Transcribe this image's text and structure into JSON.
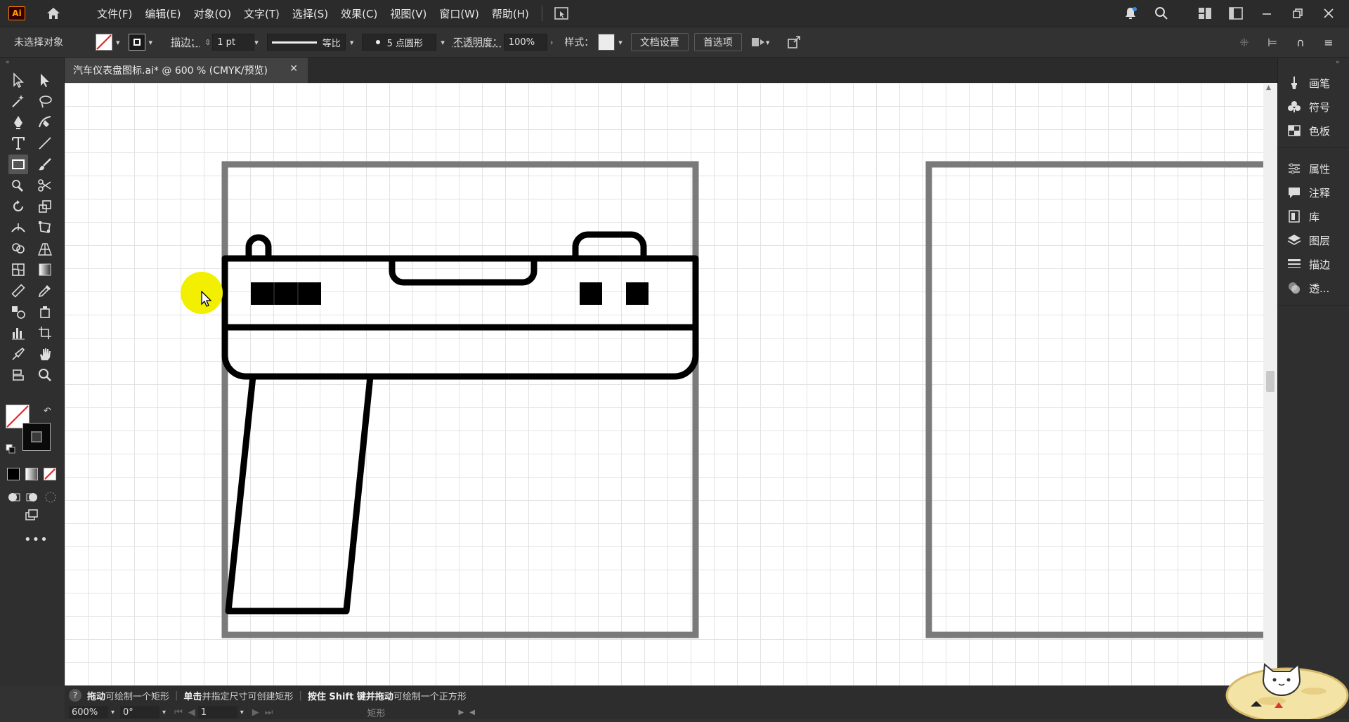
{
  "app": {
    "logo": "Ai",
    "window_controls": [
      "minimize",
      "restore",
      "close"
    ]
  },
  "menu": [
    "文件(F)",
    "编辑(E)",
    "对象(O)",
    "文字(T)",
    "选择(S)",
    "效果(C)",
    "视图(V)",
    "窗口(W)",
    "帮助(H)"
  ],
  "control_bar": {
    "selection_status": "未选择对象",
    "stroke_label": "描边：",
    "stroke_weight": "1 pt",
    "stroke_profile": "等比",
    "brush": "5 点圆形",
    "opacity_label": "不透明度：",
    "opacity_value": "100%",
    "style_label": "样式：",
    "doc_setup_button": "文档设置",
    "preferences_button": "首选项"
  },
  "tab": {
    "title": "汽车仪表盘图标.ai* @ 600 % (CMYK/预览)"
  },
  "right_panel": {
    "group1": [
      "画笔",
      "符号",
      "色板"
    ],
    "group2": [
      "属性",
      "注释",
      "库",
      "图层",
      "描边",
      "透..."
    ]
  },
  "status": {
    "hint1_bold": "拖动",
    "hint1": "可绘制一个矩形",
    "hint2_bold": "单击",
    "hint2": "并指定尺寸可创建矩形",
    "hint3_bold": "按住 Shift 键并拖动",
    "hint3": "可绘制一个正方形",
    "zoom": "600%",
    "rotation": "0°",
    "artboard": "1",
    "tool_name": "矩形"
  },
  "colors": {
    "accent": "#ff9a00",
    "cursor_highlight": "#f2ef00",
    "artwork_stroke": "#000000",
    "artboard_frame": "#777777"
  }
}
